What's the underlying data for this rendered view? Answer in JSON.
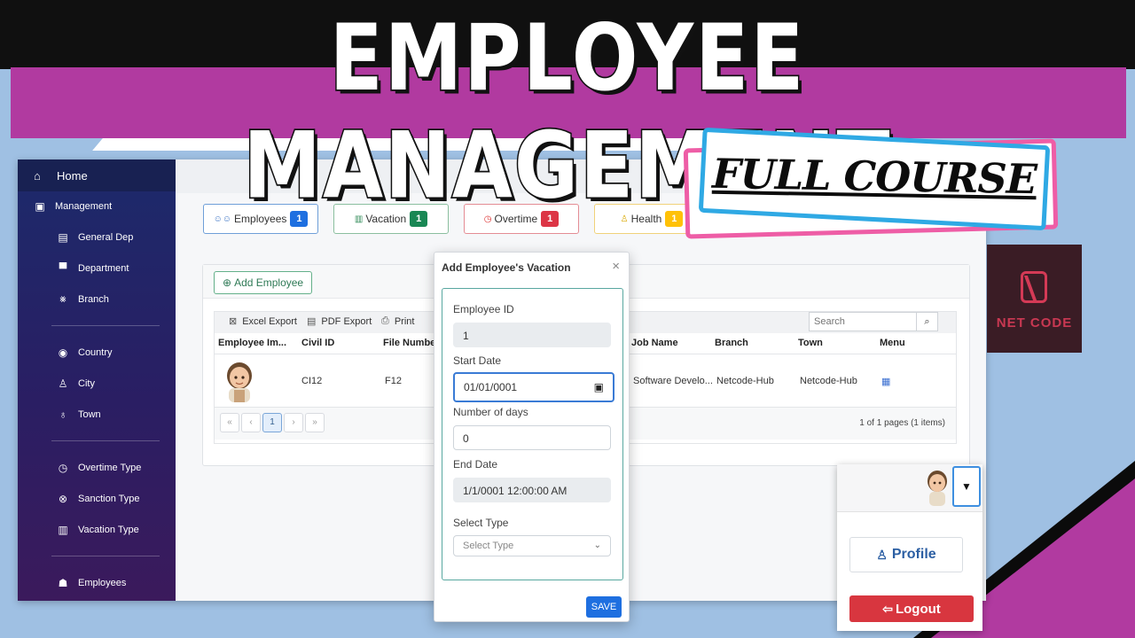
{
  "banner": {
    "title": "EMPLOYEE MANAGEMENT",
    "subtitle": "FULL COURSE"
  },
  "colors": {
    "purple": "#b13aa0",
    "navy": "#1c2a6b",
    "primary": "#1e6fe0",
    "danger": "#d8363f"
  },
  "sidebar": {
    "home": "Home",
    "management": "Management",
    "items": [
      {
        "label": "General Dep",
        "icon": "id-card-icon"
      },
      {
        "label": "Department",
        "icon": "building-icon"
      },
      {
        "label": "Branch",
        "icon": "branch-icon"
      },
      {
        "label": "Country",
        "icon": "location-pin-icon"
      },
      {
        "label": "City",
        "icon": "person-pin-icon"
      },
      {
        "label": "Town",
        "icon": "map-pin-icon"
      },
      {
        "label": "Overtime Type",
        "icon": "clock-icon"
      },
      {
        "label": "Sanction Type",
        "icon": "x-circle-icon"
      },
      {
        "label": "Vacation Type",
        "icon": "clipboard-icon"
      },
      {
        "label": "Employees",
        "icon": "users-icon"
      }
    ]
  },
  "stats": [
    {
      "label": "Employees",
      "count": "1",
      "color": "#1e6fe0"
    },
    {
      "label": "Vacation",
      "count": "1",
      "color": "#198754"
    },
    {
      "label": "Overtime",
      "count": "1",
      "color": "#dc3545"
    },
    {
      "label": "Health",
      "count": "1",
      "color": "#ffc107"
    }
  ],
  "grid": {
    "add_button": "Add Employee",
    "toolbar": {
      "excel": "Excel Export",
      "pdf": "PDF Export",
      "print": "Print",
      "search_placeholder": "Search"
    },
    "columns": [
      "Employee Im...",
      "Civil ID",
      "File Number",
      "Job Name",
      "Branch",
      "Town",
      "Menu"
    ],
    "row": {
      "civil_id": "CI12",
      "file_number": "F12",
      "job_name": "Software Develo...",
      "branch": "Netcode-Hub",
      "town": "Netcode-Hub"
    },
    "pager": {
      "first": "«",
      "prev": "‹",
      "page": "1",
      "next": "›",
      "last": "»",
      "info": "1 of 1 pages (1 items)"
    }
  },
  "modal": {
    "title": "Add Employee's Vacation",
    "close": "×",
    "employee_id_label": "Employee ID",
    "employee_id": "1",
    "start_date_label": "Start Date",
    "start_date": "01/01/0001",
    "days_label": "Number of days",
    "days": "0",
    "end_date_label": "End Date",
    "end_date": "1/1/0001 12:00:00 AM",
    "type_label": "Select Type",
    "type_placeholder": "Select Type",
    "save": "SAVE"
  },
  "profile_menu": {
    "profile": "Profile",
    "logout": "Logout"
  },
  "logo": {
    "text": "NET CODE"
  }
}
